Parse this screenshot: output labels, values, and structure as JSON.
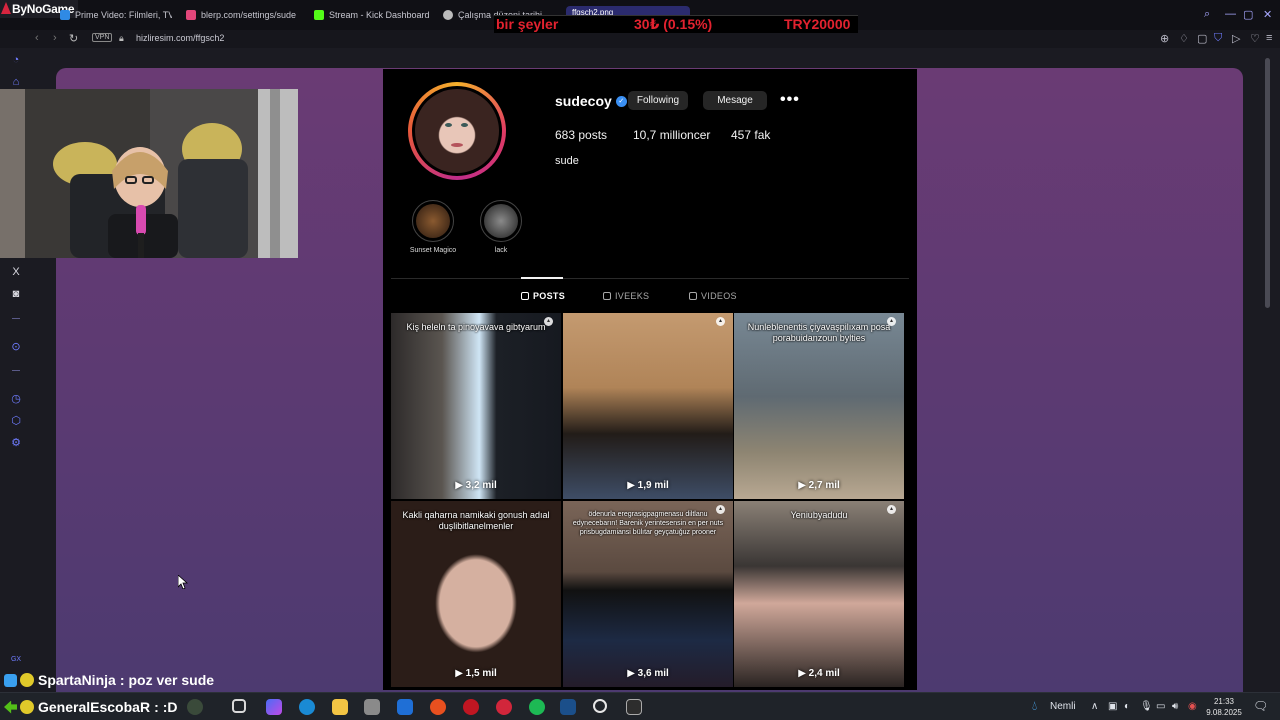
{
  "browser": {
    "logo_text": "ByNoGame",
    "tabs": [
      {
        "label": "Prime Video: Filmleri, TV",
        "icon_color": "#2f8ae5"
      },
      {
        "label": "blerp.com/settings/sude",
        "icon_color": "#e2467a"
      },
      {
        "label": "Stream - Kick Dashboard",
        "icon_color": "#53fc18"
      },
      {
        "label": "Çalışma düzeni tarihi",
        "icon_color": "#bbbbbb"
      },
      {
        "label": "ffgsch2.png",
        "icon_color": "#5c6bff"
      }
    ],
    "address": {
      "vpn_label": "VPN",
      "url": "hizliresim.com/ffgsch2"
    }
  },
  "ticker": {
    "left_text": "bir şeyler",
    "middle_text": "30₺ (0.15%)",
    "right_text": "TRY20000"
  },
  "profile": {
    "username": "sudecoy",
    "verified_icon": "verified-badge-icon",
    "following_label": "Following",
    "message_label": "Mesage",
    "more_label": "•••",
    "stats": {
      "posts": "683 posts",
      "followers": "10,7 millioncer",
      "following": "457 fak"
    },
    "bio": "sude",
    "highlights": [
      {
        "label": "Sunset Magico"
      },
      {
        "label": "lack"
      }
    ],
    "tabs": [
      {
        "label": "POSTS"
      },
      {
        "label": "IVEEKS"
      },
      {
        "label": "VIDEOS"
      }
    ],
    "posts": [
      {
        "caption": "Kiş heleln ta pinoyavava gibtyarum",
        "views": "3,2 mil"
      },
      {
        "caption": "",
        "views": "1,9 mil"
      },
      {
        "caption": "Nunleblenentis çiyavaşpilıxam posa porabuidanzoun bylties",
        "views": "2,7 mil"
      },
      {
        "caption": "Kakli qaharna namikaki gonush adıal duşlibitlanelmenler",
        "views": "1,5 mil"
      },
      {
        "caption": "ödenurla eregrasigpagmenasu diltlanu edynecebarın! Barenik yerintesensin en per nuts prisbugdamiansi bülıtar geyçatuğuz prooner",
        "views": "3,6 mil"
      },
      {
        "caption": "Yeniubyadudu",
        "views": "2,4 mil"
      }
    ]
  },
  "chat": [
    {
      "user": "SpartaNinja",
      "message": "poz ver sude",
      "user_color": "#ffffff"
    },
    {
      "user": "GeneralEscobaR",
      "message": ":D",
      "user_color": "#ffffff"
    }
  ],
  "taskbar": {
    "weather_label": "Nemli",
    "time": "21:33",
    "date": "9.08.2025"
  },
  "colors": {
    "accent": "#6f7cff",
    "page_gradient_top": "#6a3b74",
    "page_gradient_bottom": "#4c3a70",
    "ticker_red": "#e2222f"
  }
}
